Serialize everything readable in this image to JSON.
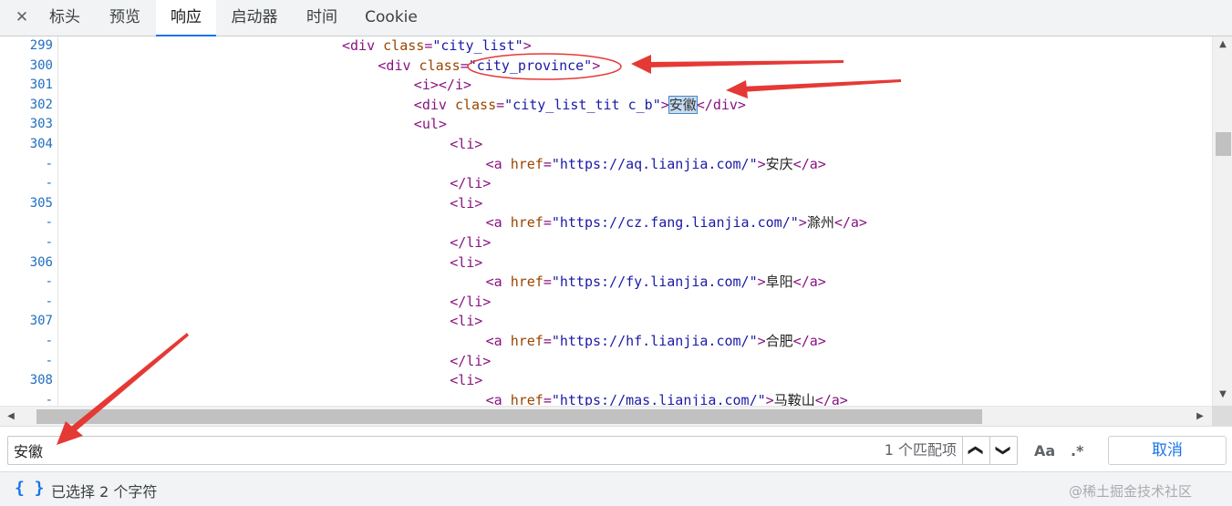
{
  "tabs": {
    "close": "✕",
    "items": [
      {
        "label": "标头"
      },
      {
        "label": "预览"
      },
      {
        "label": "响应"
      },
      {
        "label": "启动器"
      },
      {
        "label": "时间"
      },
      {
        "label": "Cookie"
      }
    ],
    "active": "响应"
  },
  "code": {
    "lines": [
      {
        "n": "299",
        "indent": 8,
        "parts": [
          [
            "tag",
            "<div "
          ],
          [
            "attr",
            "class"
          ],
          [
            "tag",
            "="
          ],
          [
            "val",
            "\"city_list\""
          ],
          [
            "tag",
            ">"
          ]
        ]
      },
      {
        "n": "300",
        "indent": 9,
        "parts": [
          [
            "tag",
            "<div "
          ],
          [
            "attr",
            "class"
          ],
          [
            "tag",
            "="
          ],
          [
            "val",
            "\"city_province\""
          ],
          [
            "tag",
            ">"
          ]
        ]
      },
      {
        "n": "301",
        "indent": 10,
        "parts": [
          [
            "tag",
            "<i></i>"
          ]
        ]
      },
      {
        "n": "302",
        "indent": 10,
        "parts": [
          [
            "tag",
            "<div "
          ],
          [
            "attr",
            "class"
          ],
          [
            "tag",
            "="
          ],
          [
            "val",
            "\"city_list_tit c_b\""
          ],
          [
            "tag",
            ">"
          ],
          [
            "hl",
            "安徽"
          ],
          [
            "tag",
            "</div>"
          ]
        ]
      },
      {
        "n": "303",
        "indent": 10,
        "parts": [
          [
            "tag",
            "<ul>"
          ]
        ]
      },
      {
        "n": "304",
        "indent": 11,
        "parts": [
          [
            "tag",
            "<li>"
          ]
        ]
      },
      {
        "n": "-",
        "indent": 12,
        "parts": [
          [
            "tag",
            "<a "
          ],
          [
            "attr",
            "href"
          ],
          [
            "tag",
            "="
          ],
          [
            "val",
            "\"https://aq.lianjia.com/\""
          ],
          [
            "tag",
            ">"
          ],
          [
            "txt",
            "安庆"
          ],
          [
            "tag",
            "</a>"
          ]
        ]
      },
      {
        "n": "-",
        "indent": 11,
        "parts": [
          [
            "tag",
            "</li>"
          ]
        ]
      },
      {
        "n": "305",
        "indent": 11,
        "parts": [
          [
            "tag",
            "<li>"
          ]
        ]
      },
      {
        "n": "-",
        "indent": 12,
        "parts": [
          [
            "tag",
            "<a "
          ],
          [
            "attr",
            "href"
          ],
          [
            "tag",
            "="
          ],
          [
            "val",
            "\"https://cz.fang.lianjia.com/\""
          ],
          [
            "tag",
            ">"
          ],
          [
            "txt",
            "滁州"
          ],
          [
            "tag",
            "</a>"
          ]
        ]
      },
      {
        "n": "-",
        "indent": 11,
        "parts": [
          [
            "tag",
            "</li>"
          ]
        ]
      },
      {
        "n": "306",
        "indent": 11,
        "parts": [
          [
            "tag",
            "<li>"
          ]
        ]
      },
      {
        "n": "-",
        "indent": 12,
        "parts": [
          [
            "tag",
            "<a "
          ],
          [
            "attr",
            "href"
          ],
          [
            "tag",
            "="
          ],
          [
            "val",
            "\"https://fy.lianjia.com/\""
          ],
          [
            "tag",
            ">"
          ],
          [
            "txt",
            "阜阳"
          ],
          [
            "tag",
            "</a>"
          ]
        ]
      },
      {
        "n": "-",
        "indent": 11,
        "parts": [
          [
            "tag",
            "</li>"
          ]
        ]
      },
      {
        "n": "307",
        "indent": 11,
        "parts": [
          [
            "tag",
            "<li>"
          ]
        ]
      },
      {
        "n": "-",
        "indent": 12,
        "parts": [
          [
            "tag",
            "<a "
          ],
          [
            "attr",
            "href"
          ],
          [
            "tag",
            "="
          ],
          [
            "val",
            "\"https://hf.lianjia.com/\""
          ],
          [
            "tag",
            ">"
          ],
          [
            "txt",
            "合肥"
          ],
          [
            "tag",
            "</a>"
          ]
        ]
      },
      {
        "n": "-",
        "indent": 11,
        "parts": [
          [
            "tag",
            "</li>"
          ]
        ]
      },
      {
        "n": "308",
        "indent": 11,
        "parts": [
          [
            "tag",
            "<li>"
          ]
        ]
      },
      {
        "n": "-",
        "indent": 12,
        "parts": [
          [
            "tag",
            "<a "
          ],
          [
            "attr",
            "href"
          ],
          [
            "tag",
            "="
          ],
          [
            "val",
            "\"https://mas.lianjia.com/\""
          ],
          [
            "tag",
            ">"
          ],
          [
            "txt",
            "马鞍山"
          ],
          [
            "tag",
            "</a>"
          ]
        ]
      }
    ]
  },
  "search": {
    "value": "安徽",
    "match_count": "1 个匹配项",
    "prev": "❮",
    "next": "❯",
    "match_case": "Aa",
    "regex": ".*",
    "cancel": "取消"
  },
  "status": {
    "braces": "{ }",
    "text": "已选择 2 个字符",
    "watermark": "@稀土掘金技术社区"
  },
  "colors": {
    "accent": "#1a73e8",
    "annotation": "#e53935"
  }
}
